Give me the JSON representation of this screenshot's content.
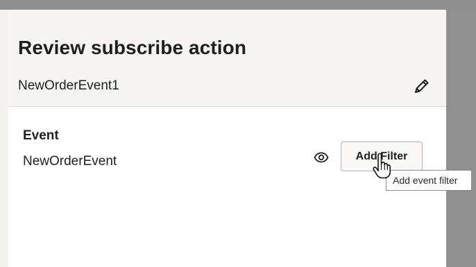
{
  "drawer": {
    "title": "Review subscribe action",
    "action_name": "NewOrderEvent1",
    "edit_icon": "pencil-icon"
  },
  "event_section": {
    "label": "Event",
    "value": "NewOrderEvent",
    "view_icon": "eye-icon",
    "add_filter_label": "Add Filter",
    "tooltip": "Add event filter"
  },
  "colors": {
    "header_bg": "#f7f5f2",
    "panel_bg": "#ffffff",
    "overlay": "#9a9a9a",
    "text": "#1f1f1f"
  }
}
